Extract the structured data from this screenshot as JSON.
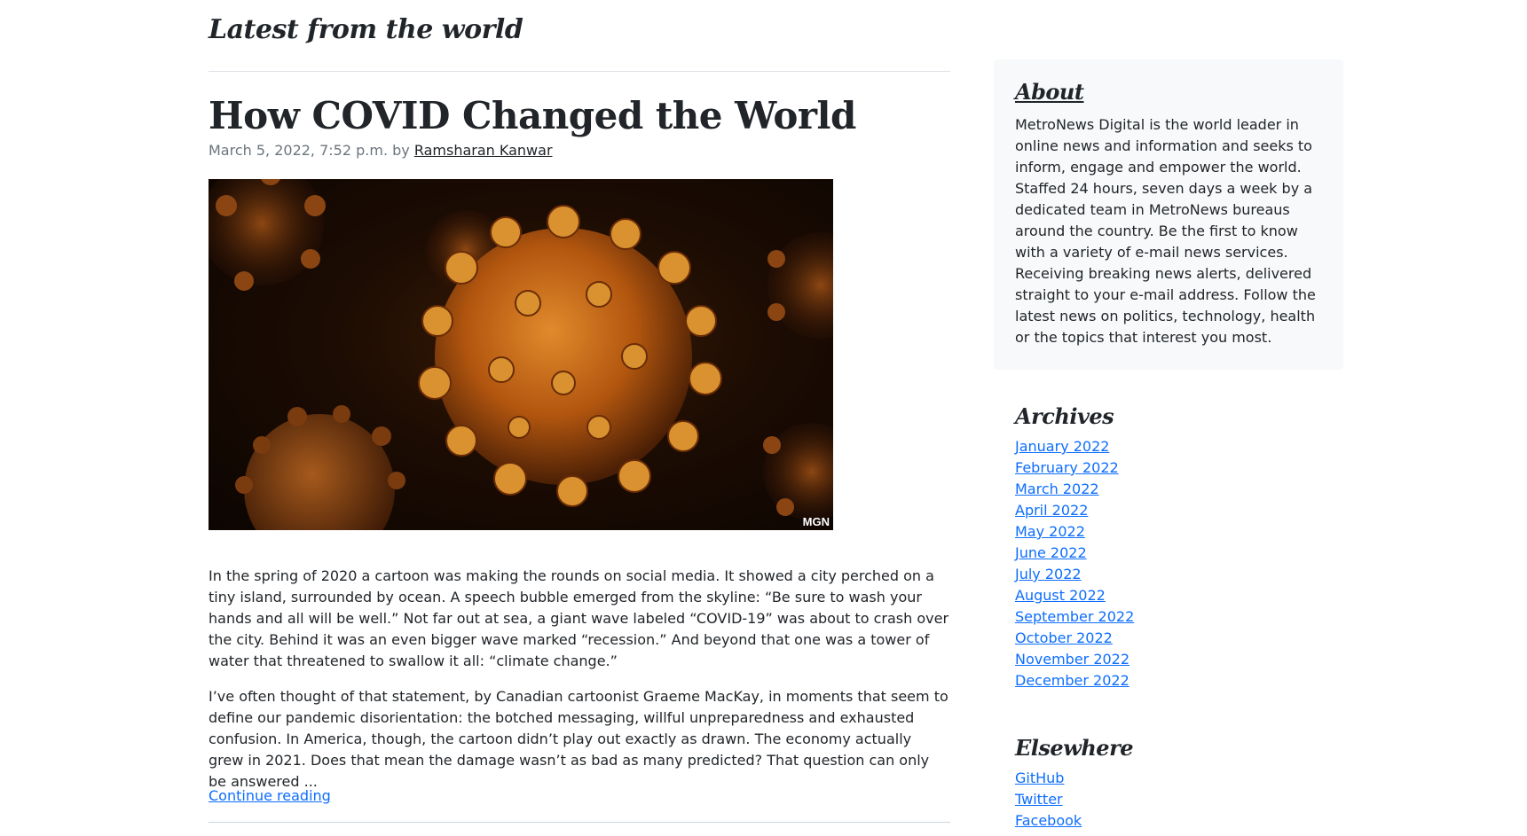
{
  "page": {
    "heading": "Latest from the world"
  },
  "post": {
    "title": "How COVID Changed the World",
    "date": "March 5, 2022, 7:52 p.m.",
    "by": "by",
    "author": "Ramsharan Kanwar",
    "image_alt": "coronavirus-illustration",
    "image_credit": "MGN",
    "paragraphs": [
      "In the spring of 2020 a cartoon was making the rounds on social media. It showed a city perched on a tiny island, surrounded by ocean. A speech bubble emerged from the skyline: “Be sure to wash your hands and all will be well.” Not far out at sea, a giant wave labeled “COVID-19” was about to crash over the city. Behind it was an even bigger wave marked “recession.” And beyond that one was a tower of water that threatened to swallow it all: “climate change.”",
      "I’ve often thought of that statement, by Canadian cartoonist Graeme MacKay, in moments that seem to define our pandemic disorientation: the botched messaging, willful unpreparedness and exhausted confusion. In America, though, the cartoon didn’t play out exactly as drawn. The economy actually grew in 2021. Does that mean the damage wasn’t as bad as many predicted? That question can only be answered ..."
    ],
    "continue_label": "Continue reading"
  },
  "sidebar": {
    "about": {
      "heading": "About",
      "text": "MetroNews Digital is the world leader in online news and information and seeks to inform, engage and empower the world. Staffed 24 hours, seven days a week by a dedicated team in MetroNews bureaus around the country. Be the first to know with a variety of e-mail news services. Receiving breaking news alerts, delivered straight to your e-mail address. Follow the latest news on politics, technology, health or the topics that interest you most."
    },
    "archives": {
      "heading": "Archives",
      "items": [
        "January 2022",
        "February 2022",
        "March 2022",
        "April 2022",
        "May 2022",
        "June 2022",
        "July 2022",
        "August 2022",
        "September 2022",
        "October 2022",
        "November 2022",
        "December 2022"
      ]
    },
    "elsewhere": {
      "heading": "Elsewhere",
      "items": [
        "GitHub",
        "Twitter",
        "Facebook"
      ]
    }
  },
  "colors": {
    "link": "#0d6efd",
    "text": "#212529",
    "muted": "#6c757d",
    "about_bg": "#f8f9fa"
  }
}
